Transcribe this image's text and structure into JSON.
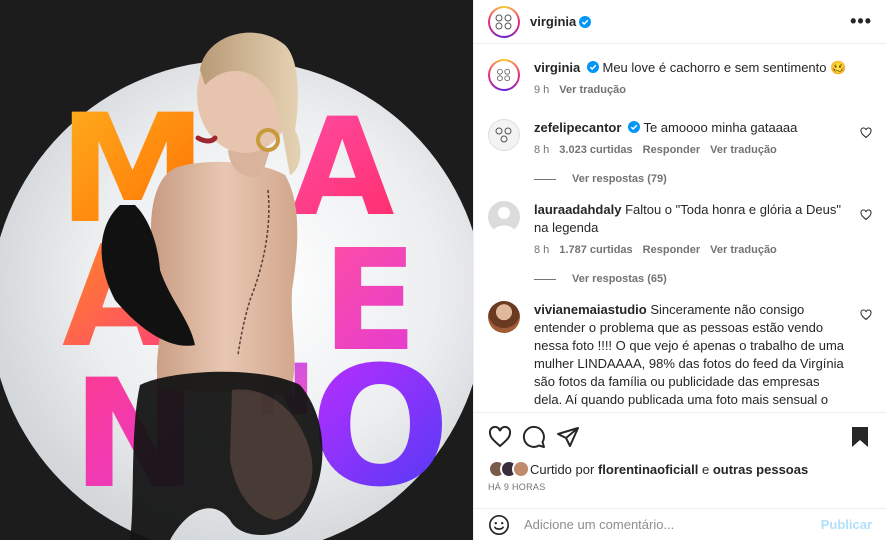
{
  "post": {
    "author": "virginia",
    "caption": {
      "username": "virginia",
      "text": "Meu love é cachorro e sem sentimento",
      "emoji": "🥴",
      "age": "9 h",
      "translate": "Ver tradução"
    }
  },
  "artwork": {
    "letters_left": [
      "M",
      "A",
      "N",
      "O"
    ],
    "letters_right": [
      "A",
      "E",
      "N",
      "O"
    ],
    "colors": {
      "orange": "#ff8a1f",
      "pink": "#ff3b8d",
      "magenta": "#e23ad6",
      "purple": "#8a2be2",
      "blue": "#5b3cf5",
      "glove": "#111111"
    }
  },
  "comments": [
    {
      "username": "zefelipecantor",
      "verified": true,
      "text": "Te amoooo minha gataaaa",
      "age": "8 h",
      "likes": "3.023 curtidas",
      "reply": "Responder",
      "translate": "Ver tradução",
      "replies": "Ver respostas (79)"
    },
    {
      "username": "lauraadahdaly",
      "verified": false,
      "text": "Faltou o \"Toda honra e glória a Deus\" na legenda",
      "age": "8 h",
      "likes": "1.787 curtidas",
      "reply": "Responder",
      "translate": "Ver tradução",
      "replies": "Ver respostas (65)"
    },
    {
      "username": "vivianemaiastudio",
      "verified": false,
      "text": "Sinceramente não consigo entender o problema que as pessoas estão vendo nessa foto !!!! O que vejo é apenas o trabalho de uma mulher LINDAAAA, 98% das fotos do feed da Virgínia são fotos da família ou publicidade das empresas dela. Aí quando publicada uma foto mais sensual o povo cai matando \" brega, exposição desnecessária, dizer que ela tá vendendo o corpo, que é onlyfans...\" aaa fala sério, cambada de amargurados ou"
    }
  ],
  "liked_by": {
    "prefix": "Curtido por",
    "user": "florentinaoficiall",
    "conj": "e",
    "others": "outras pessoas"
  },
  "posted": "HÁ 9 HORAS",
  "comment_box": {
    "placeholder": "Adicione um comentário...",
    "publish": "Publicar"
  },
  "icons": [
    "more-icon",
    "verified-icon",
    "heart-icon",
    "comment-icon",
    "share-icon",
    "bookmark-icon",
    "emoji-icon"
  ],
  "ui_colors": {
    "verified": "#0095f6",
    "muted": "#737373",
    "publish_disabled": "#b2dffc"
  }
}
